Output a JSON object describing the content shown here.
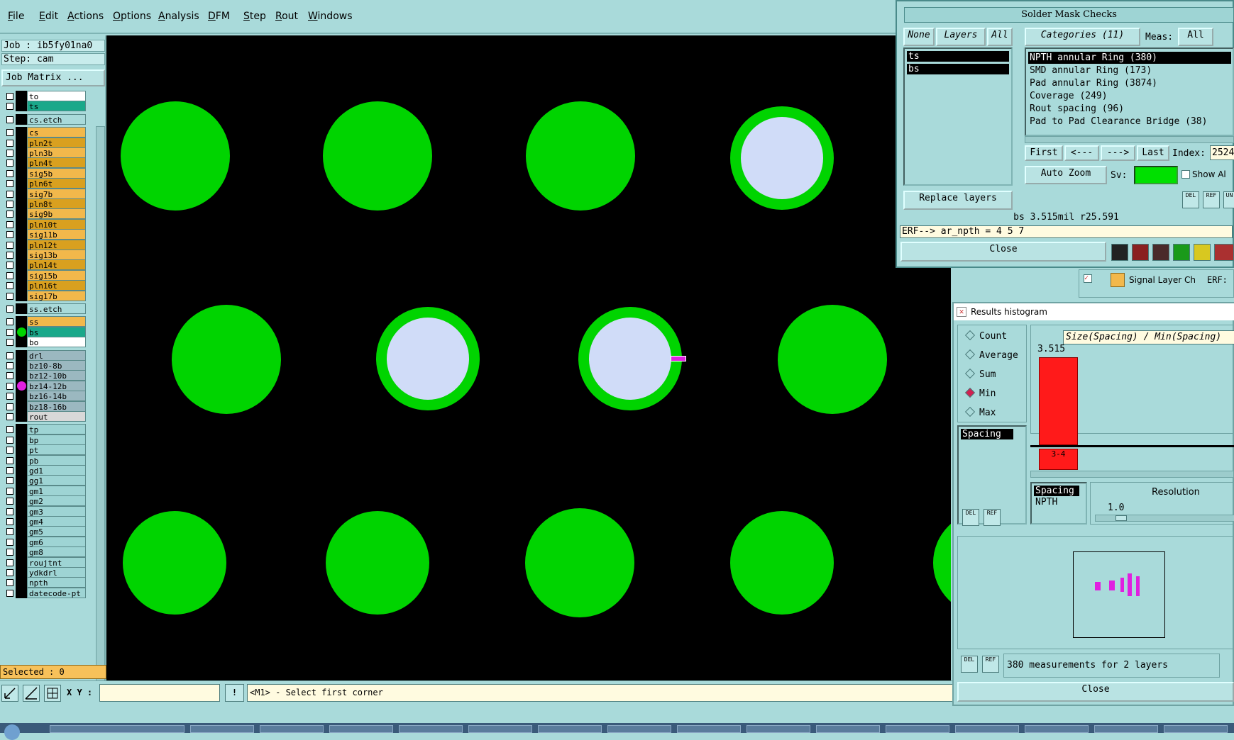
{
  "menu": [
    "File",
    "Edit",
    "Actions",
    "Options",
    "Analysis",
    "DFM",
    "Step",
    "Rout",
    "Windows"
  ],
  "left": {
    "job_label": "Job : ib5fy01na0",
    "step_label": "Step: cam",
    "job_matrix": "Job Matrix ...",
    "selected": "Selected : 0",
    "layers": [
      {
        "name": "to",
        "color": "#ffffff"
      },
      {
        "name": "ts",
        "color": "#1aa88a"
      },
      {
        "name": "cs.etch",
        "color": "#a9dada"
      },
      {
        "name": "cs",
        "color": "#f2b84b"
      },
      {
        "name": "pln2t",
        "color": "#d9a01f"
      },
      {
        "name": "pln3b",
        "color": "#f2b84b"
      },
      {
        "name": "pln4t",
        "color": "#d9a01f"
      },
      {
        "name": "sig5b",
        "color": "#f2b84b"
      },
      {
        "name": "pln6t",
        "color": "#d9a01f"
      },
      {
        "name": "sig7b",
        "color": "#f2b84b"
      },
      {
        "name": "pln8t",
        "color": "#d9a01f"
      },
      {
        "name": "sig9b",
        "color": "#f2b84b"
      },
      {
        "name": "pln10t",
        "color": "#d9a01f"
      },
      {
        "name": "sig11b",
        "color": "#f2b84b"
      },
      {
        "name": "pln12t",
        "color": "#d9a01f"
      },
      {
        "name": "sig13b",
        "color": "#f2b84b"
      },
      {
        "name": "pln14t",
        "color": "#d9a01f"
      },
      {
        "name": "sig15b",
        "color": "#f2b84b"
      },
      {
        "name": "pln16t",
        "color": "#d9a01f"
      },
      {
        "name": "sig17b",
        "color": "#f2b84b"
      },
      {
        "name": "ss.etch",
        "color": "#a9dada"
      },
      {
        "name": "ss",
        "color": "#f2b84b"
      },
      {
        "name": "bs",
        "color": "#1aa88a",
        "marker": "#00d400"
      },
      {
        "name": "bo",
        "color": "#ffffff"
      },
      {
        "name": "drl",
        "color": "#9bb8c0"
      },
      {
        "name": "bz10-8b",
        "color": "#9bb8c0"
      },
      {
        "name": "bz12-10b",
        "color": "#9bb8c0"
      },
      {
        "name": "bz14-12b",
        "color": "#9bb8c0",
        "marker": "#e020e0"
      },
      {
        "name": "bz16-14b",
        "color": "#9bb8c0"
      },
      {
        "name": "bz18-16b",
        "color": "#9bb8c0"
      },
      {
        "name": "rout",
        "color": "#d8d8d8"
      },
      {
        "name": "tp",
        "color": "#9ed4d4"
      },
      {
        "name": "bp",
        "color": "#9ed4d4"
      },
      {
        "name": "pt",
        "color": "#9ed4d4"
      },
      {
        "name": "pb",
        "color": "#9ed4d4"
      },
      {
        "name": "gd1",
        "color": "#9ed4d4"
      },
      {
        "name": "gg1",
        "color": "#9ed4d4"
      },
      {
        "name": "gm1",
        "color": "#9ed4d4"
      },
      {
        "name": "gm2",
        "color": "#9ed4d4"
      },
      {
        "name": "gm3",
        "color": "#9ed4d4"
      },
      {
        "name": "gm4",
        "color": "#9ed4d4"
      },
      {
        "name": "gm5",
        "color": "#9ed4d4"
      },
      {
        "name": "gm6",
        "color": "#9ed4d4"
      },
      {
        "name": "gm8",
        "color": "#9ed4d4"
      },
      {
        "name": "roujtnt",
        "color": "#9ed4d4"
      },
      {
        "name": "ydkdrl",
        "color": "#9ed4d4"
      },
      {
        "name": "npth",
        "color": "#9ed4d4"
      },
      {
        "name": "datecode-pt",
        "color": "#9ed4d4"
      }
    ]
  },
  "bottom": {
    "xy_label": "X Y :",
    "xy_value": "",
    "bang": "!",
    "status": "<M1> - Select first corner"
  },
  "solder_mask": {
    "title": "Solder Mask Checks",
    "btn_none": "None",
    "btn_layers": "Layers",
    "btn_all": "All",
    "categories_label": "Categories (11)",
    "meas_label": "Meas:",
    "meas_all": "All",
    "layers": [
      "ts",
      "bs"
    ],
    "categories": [
      "NPTH annular Ring (380)",
      "SMD annular Ring (173)",
      "Pad annular Ring (3874)",
      "Coverage (249)",
      "Rout spacing (96)",
      "Pad to Pad Clearance Bridge (38)"
    ],
    "nav_first": "First",
    "nav_prev": "<---",
    "nav_next": "--->",
    "nav_last": "Last",
    "index_label": "Index:",
    "index_value": "2524",
    "auto_zoom": "Auto Zoom",
    "sv_label": "Sv:",
    "show_all": "Show Al",
    "replace_layers": "Replace layers",
    "del": "DEL",
    "ref": "REF",
    "un": "UN",
    "measurement": "bs 3.515mil  r25.591",
    "erf": "ERF--> ar_npth = 4 5 7",
    "close": "Close"
  },
  "signal_strip": {
    "label": "Signal Layer Ch",
    "erf": "ERF:"
  },
  "histogram": {
    "title": "Results histogram",
    "modes": [
      "Count",
      "Average",
      "Sum",
      "Min",
      "Max"
    ],
    "selected_mode": "Min",
    "header": "Size(Spacing) / Min(Spacing)",
    "bar_value": "3.515",
    "bar_label": "3-4",
    "list1": [
      "Spacing"
    ],
    "list2": [
      "Spacing",
      "NPTH"
    ],
    "resolution_label": "Resolution",
    "resolution_value": "1.0",
    "del": "DEL",
    "ref": "REF",
    "summary": "380 measurements for 2 layers",
    "close": "Close"
  }
}
